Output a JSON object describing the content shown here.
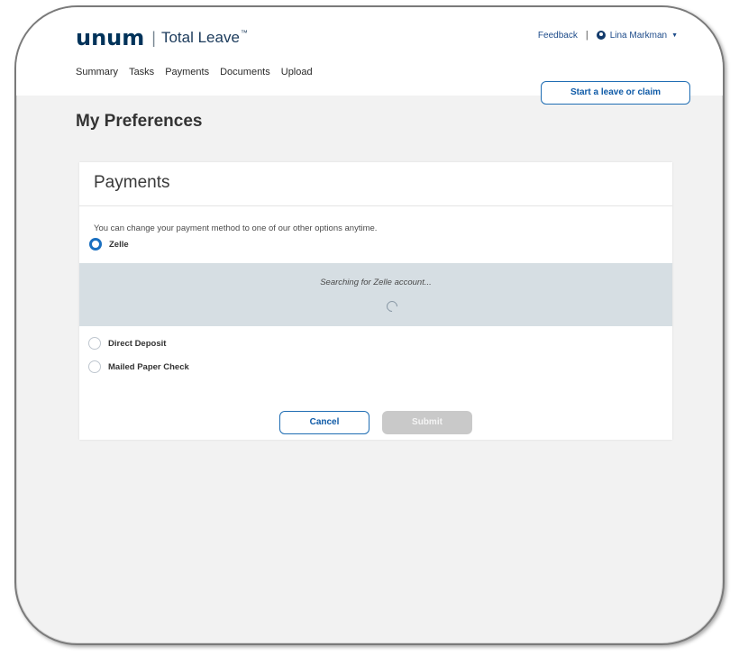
{
  "header": {
    "logo_word": "unum",
    "product": "Total Leave",
    "trademark": "™",
    "feedback": "Feedback",
    "user_name": "Lina Markman"
  },
  "nav": {
    "items": [
      "Summary",
      "Tasks",
      "Payments",
      "Documents",
      "Upload"
    ]
  },
  "actions": {
    "start_leave": "Start a leave or claim"
  },
  "page": {
    "title": "My Preferences"
  },
  "payments": {
    "heading": "Payments",
    "description": "You can change your payment method to one of our other options anytime.",
    "options": [
      {
        "label": "Zelle",
        "selected": true
      },
      {
        "label": "Direct Deposit",
        "selected": false
      },
      {
        "label": "Mailed Paper Check",
        "selected": false
      }
    ],
    "searching_text": "Searching for Zelle account...",
    "cancel_label": "Cancel",
    "submit_label": "Submit"
  },
  "colors": {
    "brand_navy": "#00335a",
    "link_blue": "#0e5aa7",
    "panel_gray": "#d6dee3"
  }
}
